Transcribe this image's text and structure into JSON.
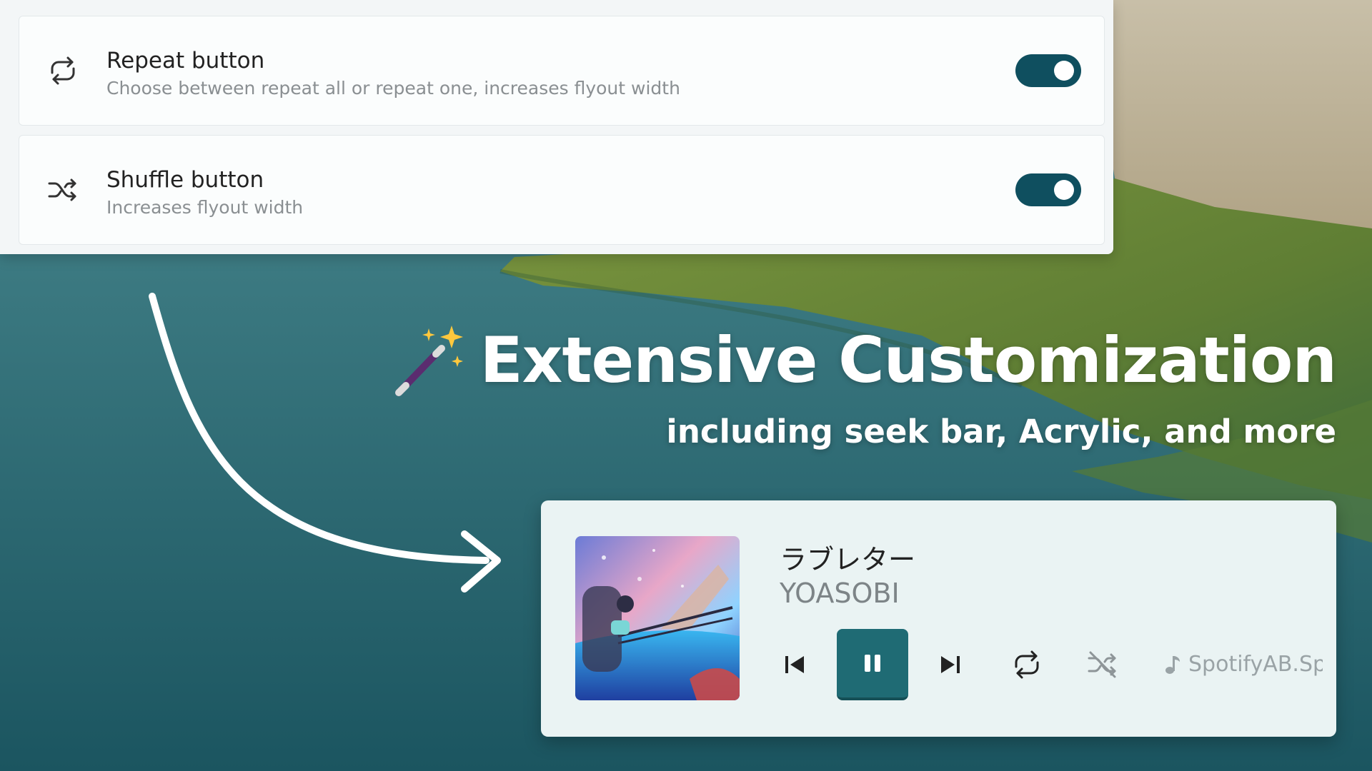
{
  "settings": {
    "items": [
      {
        "icon": "repeat-icon",
        "title": "Repeat button",
        "description": "Choose between repeat all or repeat one, increases flyout width",
        "enabled": true
      },
      {
        "icon": "shuffle-icon",
        "title": "Shuffle button",
        "description": "Increases flyout width",
        "enabled": true
      }
    ]
  },
  "headline": {
    "icon": "magic-wand-icon",
    "title": "Extensive Customization",
    "subtitle": "including seek bar, Acrylic, and more"
  },
  "flyout": {
    "song_title": "ラブレター",
    "artist": "YOASOBI",
    "source_app": "SpotifyAB.Sp",
    "controls": [
      "previous-icon",
      "pause-icon",
      "next-icon",
      "repeat-icon",
      "shuffle-off-icon"
    ],
    "state": "playing"
  },
  "colors": {
    "toggle_on": "#0f4f5f",
    "play_button": "#1f6b74",
    "panel_bg": "#f3f6f7",
    "flyout_bg": "#eaf3f3"
  }
}
